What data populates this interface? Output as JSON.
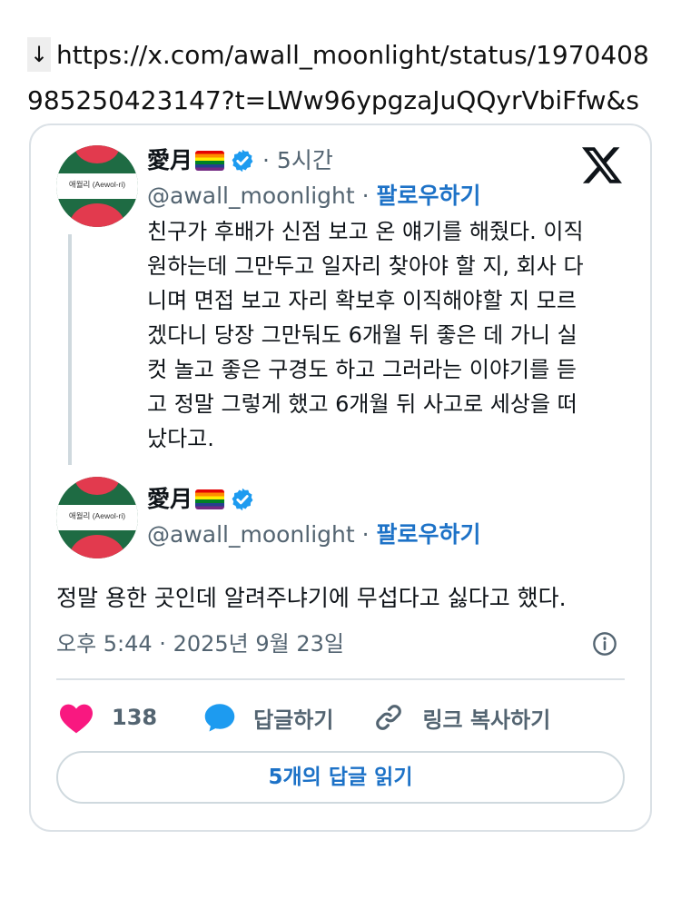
{
  "url": {
    "arrow": "↓",
    "text": "https://x.com/awall_moonlight/status/1970408985250423147?t=LWw96ypgzaJuQQyrVbiFfw&s"
  },
  "avatar_label": "애월리 (Aewol-ri)",
  "tweet1": {
    "name": "愛月",
    "time": "· 5시간",
    "handle": "@awall_moonlight",
    "separator": " · ",
    "follow": "팔로우하기",
    "lines": [
      "친구가 후배가 신점 보고 온 얘기를 해줬다. 이직",
      "원하는데 그만두고 일자리 찾아야 할 지, 회사 다",
      "니며 면접 보고 자리 확보후 이직해야할 지 모르",
      "겠다니 당장 그만둬도 6개월 뒤 좋은 데 가니 실",
      "컷 놀고 좋은 구경도 하고 그러라는 이야기를 듣",
      "고 정말 그렇게 했고 6개월 뒤 사고로 세상을 떠",
      "났다고."
    ]
  },
  "tweet2": {
    "name": "愛月",
    "handle": "@awall_moonlight",
    "separator": " · ",
    "follow": "팔로우하기",
    "text": "정말 용한 곳인데 알려주냐기에 무섭다고 싫다고 했다."
  },
  "timestamp": "오후 5:44 · 2025년 9월 23일",
  "actions": {
    "like_count": "138",
    "reply_label": "답글하기",
    "copy_link_label": "링크 복사하기"
  },
  "read_replies_label": "5개의 답글 읽기",
  "colors": {
    "like": "#f91880",
    "accent": "#1d72c7",
    "verified": "#1d9bf0",
    "muted": "#536471",
    "border": "#dbe1e6"
  }
}
